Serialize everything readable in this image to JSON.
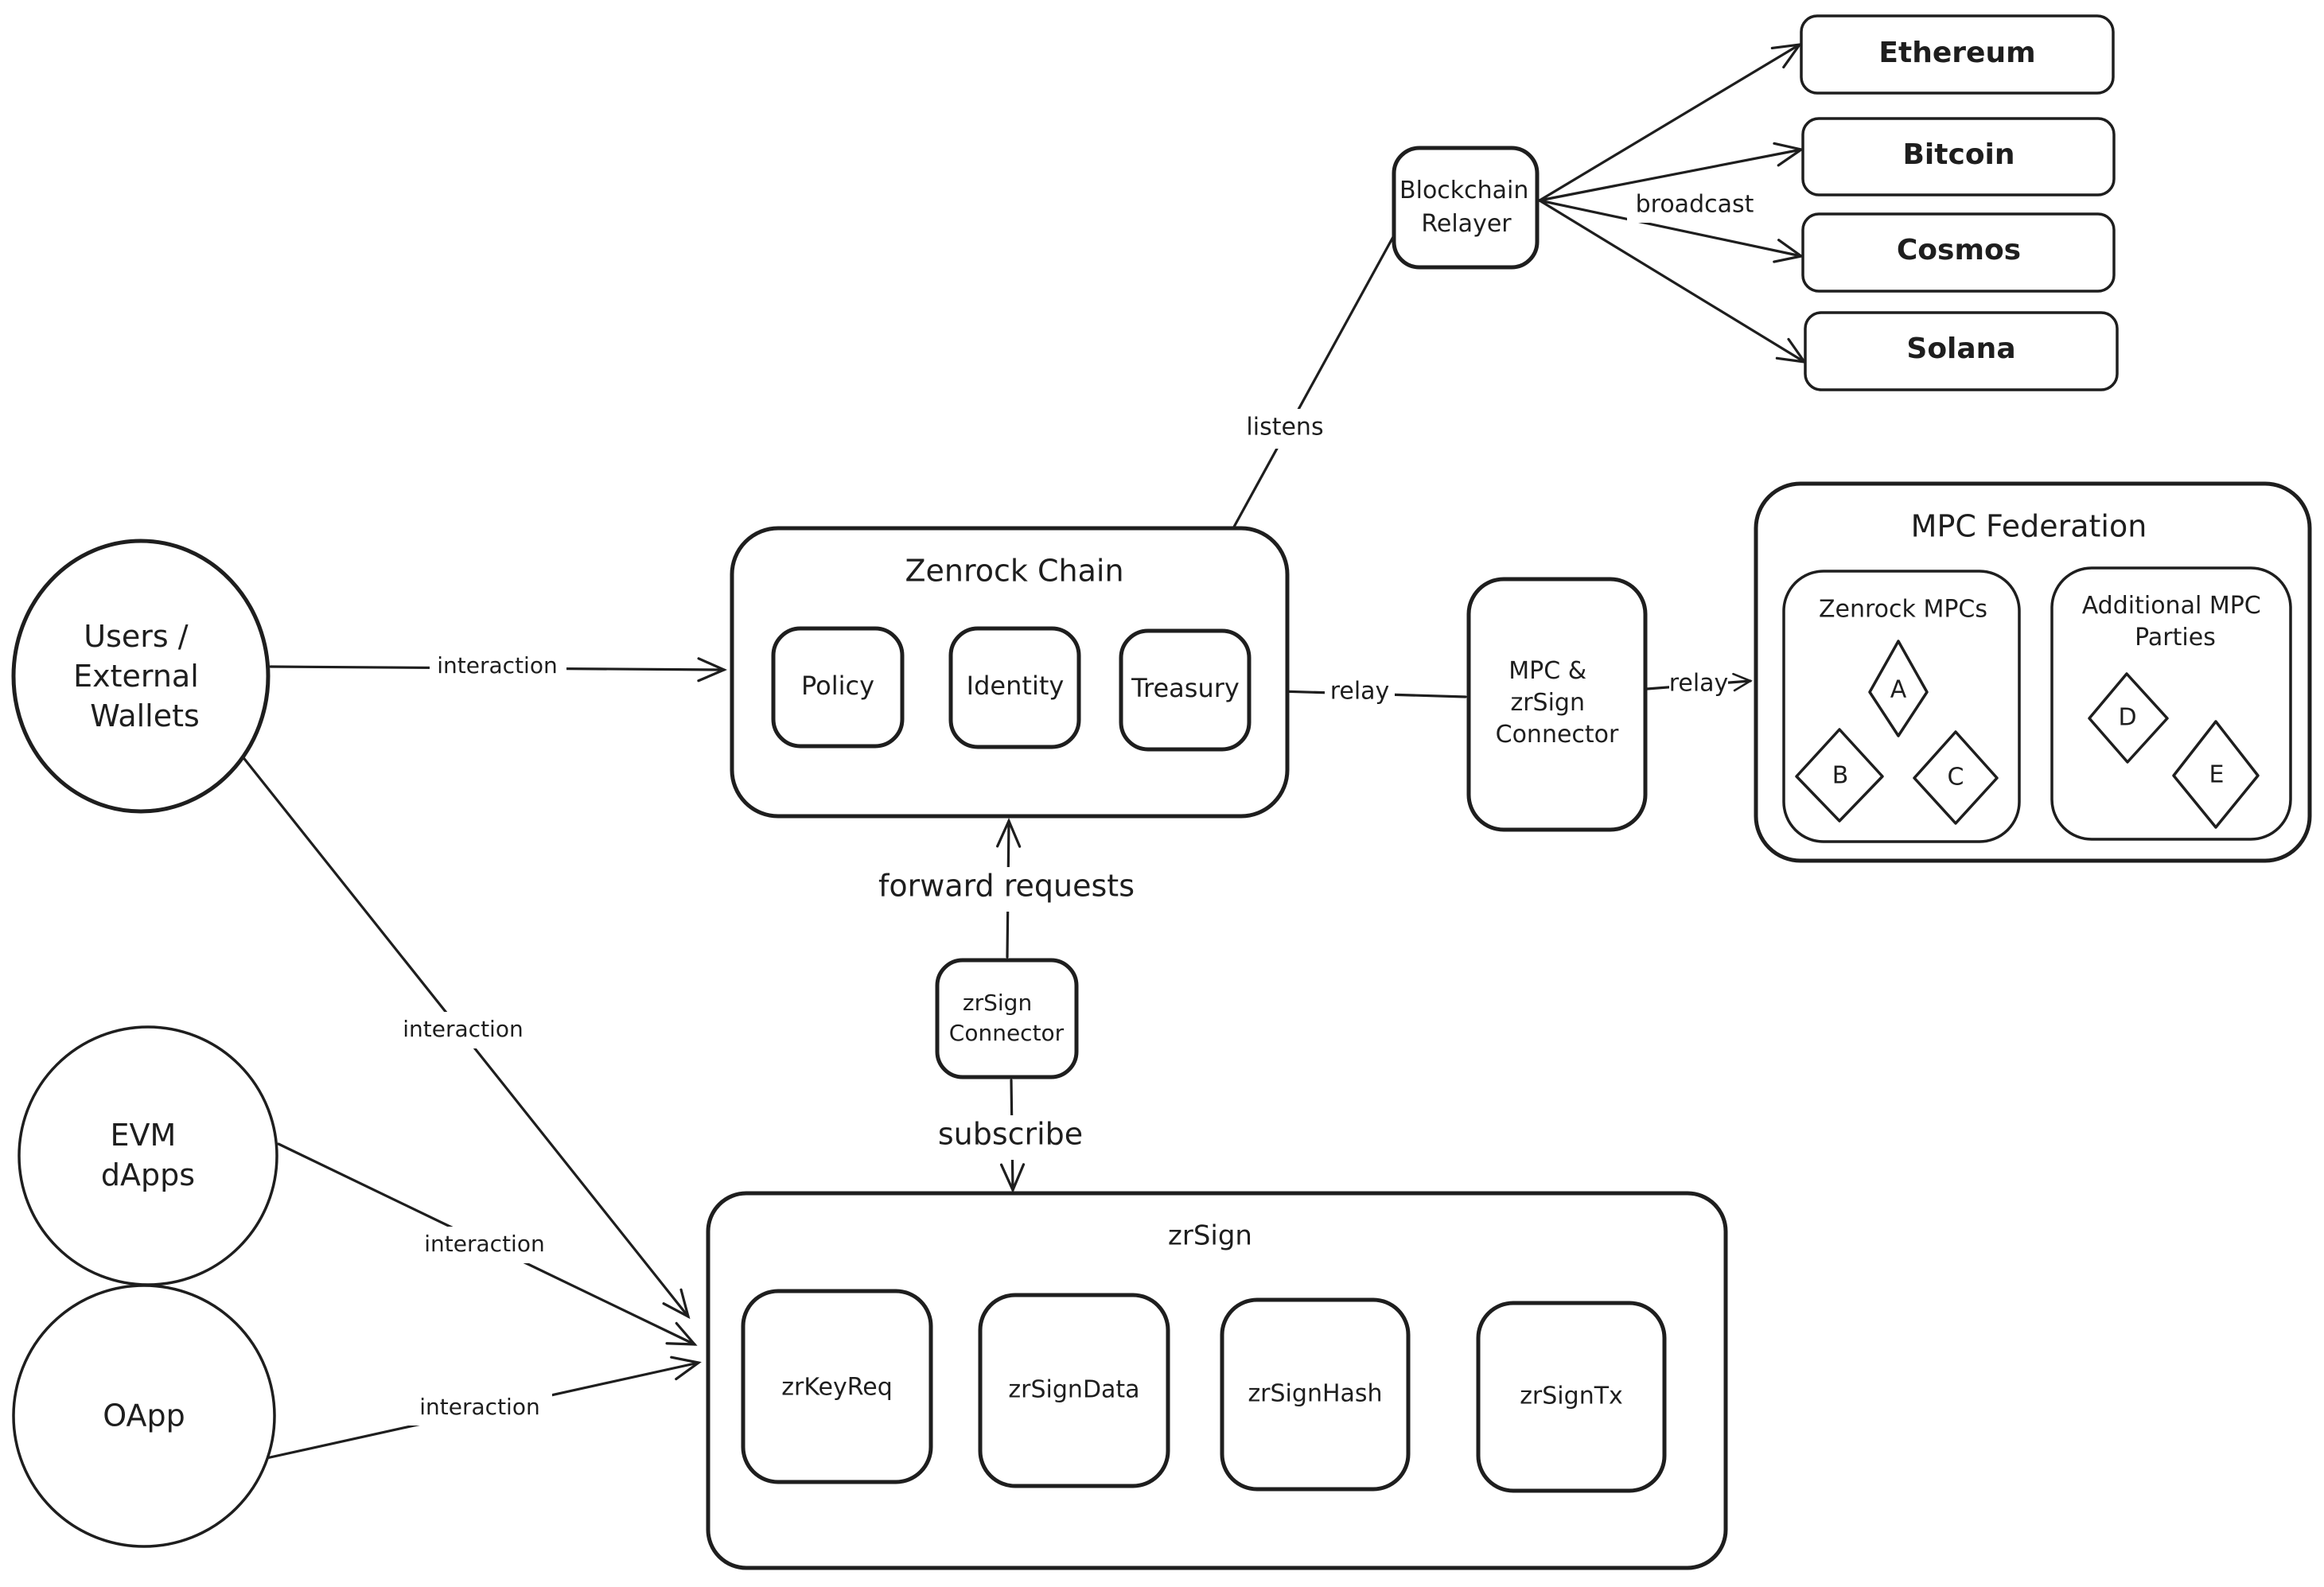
{
  "colors": {
    "stroke": "#1e1e1e",
    "background": "#ffffff"
  },
  "nodes": {
    "users": {
      "label_lines": [
        "Users /",
        "External",
        "Wallets"
      ],
      "shape": "circle"
    },
    "evm_dapps": {
      "label_lines": [
        "EVM",
        "dApps"
      ],
      "shape": "circle"
    },
    "oapp": {
      "label_lines": [
        "OApp"
      ],
      "shape": "circle"
    },
    "zenrock_chain": {
      "title": "Zenrock Chain",
      "modules": [
        "Policy",
        "Identity",
        "Treasury"
      ]
    },
    "blockchain_relayer": {
      "label_lines": [
        "Blockchain",
        "Relayer"
      ]
    },
    "chains": [
      "Ethereum",
      "Bitcoin",
      "Cosmos",
      "Solana"
    ],
    "mpc_connector": {
      "label_lines": [
        "MPC &",
        "zrSign",
        "Connector"
      ]
    },
    "mpc_federation": {
      "title": "MPC Federation",
      "groups": [
        {
          "title_lines": [
            "Zenrock MPCs"
          ],
          "parties": [
            "A",
            "B",
            "C"
          ]
        },
        {
          "title_lines": [
            "Additional MPC",
            "Parties"
          ],
          "parties": [
            "D",
            "E"
          ]
        }
      ]
    },
    "zrsign_connector": {
      "label_lines": [
        "zrSign",
        "Connector"
      ]
    },
    "zrsign": {
      "title": "zrSign",
      "modules": [
        "zrKeyReq",
        "zrSignData",
        "zrSignHash",
        "zrSignTx"
      ]
    }
  },
  "edges": {
    "users_to_chain": "interaction",
    "users_to_zrsign": "interaction",
    "evm_to_zrsign": "interaction",
    "oapp_to_zrsign": "interaction",
    "relayer_listens": "listens",
    "relayer_broadcast": "broadcast",
    "connector_to_treasury": "relay",
    "connector_to_federation": "relay",
    "forward_requests": "forward requests",
    "subscribe": "subscribe"
  }
}
